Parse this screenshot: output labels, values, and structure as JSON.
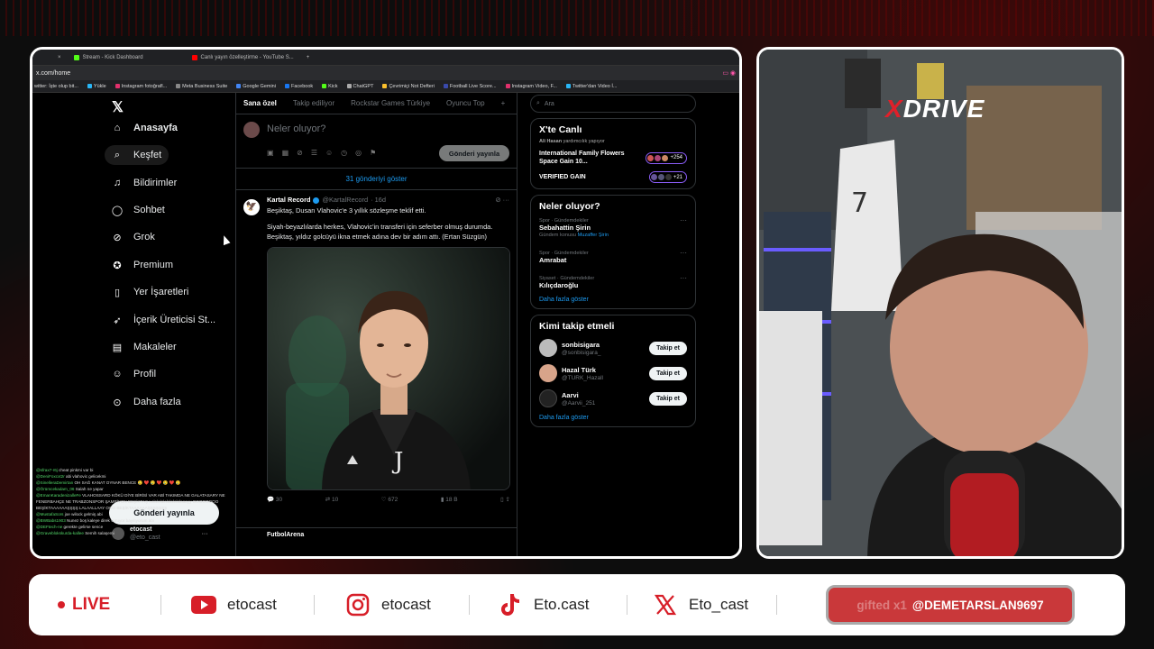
{
  "browser": {
    "tabs": [
      "Stream - Kick Dashboard",
      "Canlı yayın özelleştirme - YouTube S..."
    ],
    "new_tab": "+",
    "close": "×",
    "url": "x.com/home",
    "bookmarks": [
      "witter: İşte olup bit...",
      "Yükle",
      "Instagram fotoğrafl...",
      "Meta Business Suite",
      "Google Gemini",
      "Facebook",
      "Kick",
      "ChatGPT",
      "Çevrimiçi Not Defteri",
      "Football Live Score...",
      "Instagram Video, F...",
      "Twitter'dan Video İ..."
    ]
  },
  "nav": {
    "items": [
      "Anasayfa",
      "Keşfet",
      "Bildirimler",
      "Sohbet",
      "Grok",
      "Premium",
      "Yer İşaretleri",
      "İçerik Üreticisi St...",
      "Makaleler",
      "Profil",
      "Daha fazla"
    ],
    "post_button": "Gönderi yayınla",
    "account_name": "etocast",
    "account_handle": "@eto_cast"
  },
  "chat": [
    {
      "user": "@sfrax7-r6j",
      "msg": "cheat pinkmi var bi"
    },
    {
      "user": "@DeniFoxcxt2r",
      "msg": "abi vlahovic gelicekmi"
    },
    {
      "user": "@SinelleraDemirtan",
      "msg": "OH SAĞ KANAT OYNAR BENCE 🥲 ❤️ 🥲 ❤️ 🥲 ❤️ 🥲"
    },
    {
      "user": "@Örümcekadam_06",
      "msg": "Salah ne yapar"
    },
    {
      "user": "@EmanKaradenizalleFe",
      "msg": "VLAHOSSARD KÖKÜ DİYE BİRİSİ VAR ABİ TAKIMDA NE GALATASARY NE FENERBAHÇE NE TRABZONSPOR ŞAMPİYON BEŞİKTAŞ Lalalalalalalalalalaaayy OOOOOOOO BEŞİKTAAAAAAŞŞŞŞ LALAALLAAY OOO BEŞİKTAAAAAAŞŞŞŞŞŞŞ"
    },
    {
      "user": "@MustafaSors",
      "msg": "joe wilock gelmiş abi"
    },
    {
      "user": "@BWBabs1903",
      "msg": "Nunez boş kaleye direk vuruyor bayılıyorum abi"
    },
    {
      "user": "@DEFtech-ne",
      "msg": "gerekte gelirse sence"
    },
    {
      "user": "@Graveblokskurda-kallee",
      "msg": "Semih salaşemi"
    }
  ],
  "feed": {
    "tabs": [
      "Sana özel",
      "Takip ediliyor",
      "Rockstar Games Türkiye",
      "Oyuncu Top"
    ],
    "tab_add": "+",
    "compose_placeholder": "Neler oluyor?",
    "compose_button": "Gönderi yayınla",
    "show_posts": "31 gönderiyi göster",
    "post": {
      "name": "Kartal Record",
      "handle": "@KartalRecord",
      "time": "· 16d",
      "line1": "Beşiktaş, Dusan Vlahovic'e 3 yıllık sözleşme teklif etti.",
      "line2": "Siyah-beyazlılarda herkes, Vlahovic'in transferi için seferber olmuş durumda. Beşiktaş, yıldız golcüyü ikna etmek adına dev bir adım attı. (Ertan Süzgün)",
      "replies": "30",
      "reposts": "10",
      "likes": "672",
      "views": "18 B"
    },
    "next_post_name": "FutbolArena"
  },
  "right": {
    "search_placeholder": "Ara",
    "live_title": "X'te Canlı",
    "live_host_name": "Ali Hasan",
    "live_host_action": "yardımcılık yapıyor",
    "live_items": [
      {
        "title": "International Family Flowers Space Gain 10...",
        "count": "+254"
      },
      {
        "title": "VERIFIED GAIN",
        "count": "+21"
      }
    ],
    "trends_title": "Neler oluyor?",
    "trends": [
      {
        "cat": "Spor · Gündemdekiler",
        "name": "Sebahattin Şirin",
        "extra": "Gündem konusu",
        "extra_name": "Muzaffer Şirin"
      },
      {
        "cat": "Spor · Gündemdekiler",
        "name": "Amrabat",
        "extra": "",
        "extra_name": ""
      },
      {
        "cat": "Siyaset · Gündemdekiler",
        "name": "Kılıçdaroğlu",
        "extra": "",
        "extra_name": ""
      }
    ],
    "show_more": "Daha fazla göster",
    "follow_title": "Kimi takip etmeli",
    "follows": [
      {
        "name": "sonbisigara",
        "handle": "@sonbisigara_",
        "button": "Takip et"
      },
      {
        "name": "Hazal Türk",
        "handle": "@TURK_Hazall",
        "button": "Takip et"
      },
      {
        "name": "Aarvi",
        "handle": "@Aarvii_251",
        "button": "Takip et"
      }
    ],
    "show_more2": "Daha fazla göster"
  },
  "cam": {
    "logo_x": "X",
    "logo_rest": "DRIVE"
  },
  "bottom": {
    "live": "LIVE",
    "youtube": "etocast",
    "instagram": "etocast",
    "tiktok": "Eto.cast",
    "x": "Eto_cast",
    "ticker_faint": "gifted x1",
    "ticker_user": "@DEMETARSLAN9697"
  },
  "colors": {
    "accent_red": "#d71e28",
    "x_blue": "#1d9bf0",
    "ticker_bg": "#c9383a"
  }
}
